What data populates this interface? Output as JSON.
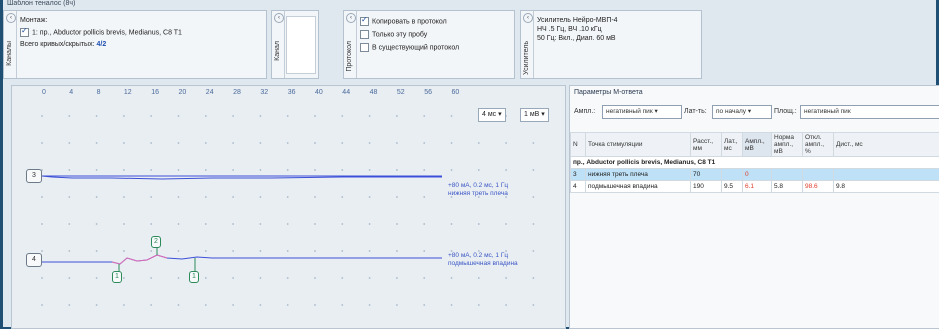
{
  "window_title": "Шаблон теналос (8ч)",
  "panel1": {
    "tab_label": "Каналы",
    "header": "Монтаж:",
    "channel": "1: пр., Abductor pollicis brevis, Medianus, C8 T1",
    "visible_label": "Всего кривых/скрытых:",
    "visible_value": "4/2"
  },
  "panel2": {
    "tab_label": "Канал"
  },
  "panel3": {
    "tab_label": "Протокол",
    "options": [
      {
        "label": "Копировать в протокол",
        "checked": true
      },
      {
        "label": "Только эту пробу",
        "checked": false
      },
      {
        "label": "В существующий протокол",
        "checked": false
      }
    ]
  },
  "panel4": {
    "tab_label": "Усилитель",
    "lines": [
      "Усилитель Нейро-МВП-4",
      "НЧ .5 Гц, ВЧ .10 кГц",
      "50 Гц: Вкл., Диап. 60 мВ"
    ]
  },
  "plot": {
    "ticks": [
      "0",
      "4",
      "8",
      "12",
      "16",
      "20",
      "24",
      "28",
      "32",
      "36",
      "40",
      "44",
      "48",
      "52",
      "56",
      "60"
    ],
    "sweep_select": "4 мс",
    "gain_select": "1 мВ",
    "channels": [
      {
        "id": "3",
        "label_lines": [
          "+80 мА, 0.2 мс, 1 Гц",
          "нижняя треть плеча"
        ]
      },
      {
        "id": "4",
        "label_lines": [
          "+80 мА, 0.2 мс, 1 Гц",
          "подмышечная впадина"
        ]
      }
    ],
    "markers": [
      "1",
      "2",
      "1"
    ]
  },
  "params": {
    "title": "Параметры М-ответа",
    "filters": [
      {
        "label": "Ампл.:",
        "value": "негативный пик"
      },
      {
        "label": "Лат-ть:",
        "value": "по началу"
      },
      {
        "label": "Площ.:",
        "value": "негативный пик"
      }
    ],
    "columns": [
      "N",
      "Точка стимуляции",
      "Расст., мм",
      "Лат., мс",
      "Ампл., мВ",
      "Норма ампл., мВ",
      "Откл. ампл., %",
      "Дист., мс"
    ],
    "group_title": "пр., Abductor pollicis brevis, Medianus, C8 T1",
    "rows": [
      {
        "n": "3",
        "point": "нижняя треть плеча",
        "dist": "70",
        "lat": "",
        "amp": "0",
        "norm": "",
        "dev": "",
        "dur": ""
      },
      {
        "n": "4",
        "point": "подмышечная впадина",
        "dist": "190",
        "lat": "9.5",
        "amp": "6.1",
        "norm": "5.8",
        "dev": "98.6",
        "dur": "9.8"
      }
    ]
  },
  "colors": {
    "trace_blue": "#3b4fd8",
    "trace_pink": "#e06cb4",
    "marker_green": "#2c8a58",
    "accent_red": "#e03c2a"
  }
}
